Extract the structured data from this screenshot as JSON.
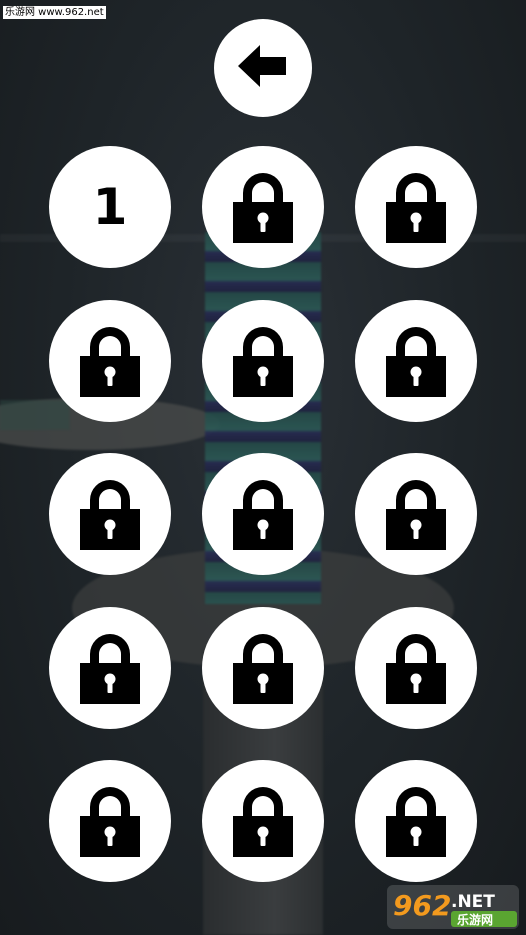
{
  "watermark": {
    "top_text": "乐游网 www.962.net",
    "logo_text": "962.NET",
    "logo_subtext": "乐游网"
  },
  "back_button": {
    "icon": "arrow-left-icon"
  },
  "levels": [
    {
      "label": "1",
      "locked": false
    },
    {
      "label": "",
      "locked": true
    },
    {
      "label": "",
      "locked": true
    },
    {
      "label": "",
      "locked": true
    },
    {
      "label": "",
      "locked": true
    },
    {
      "label": "",
      "locked": true
    },
    {
      "label": "",
      "locked": true
    },
    {
      "label": "",
      "locked": true
    },
    {
      "label": "",
      "locked": true
    },
    {
      "label": "",
      "locked": true
    },
    {
      "label": "",
      "locked": true
    },
    {
      "label": "",
      "locked": true
    },
    {
      "label": "",
      "locked": true
    },
    {
      "label": "",
      "locked": true
    },
    {
      "label": "",
      "locked": true
    }
  ],
  "colors": {
    "button_bg": "#ffffff",
    "icon": "#000000",
    "background": "#1c2125",
    "logo_orange": "#f39a1e",
    "logo_green": "#5aa531"
  }
}
